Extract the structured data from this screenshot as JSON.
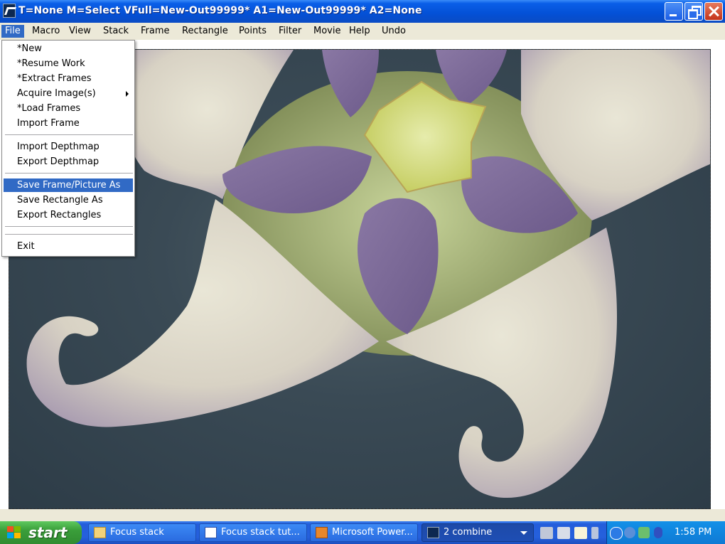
{
  "window": {
    "title": "T=None M=Select VFull=New-Out99999* A1=New-Out99999* A2=None"
  },
  "menubar": {
    "items": [
      {
        "label": "File"
      },
      {
        "label": "Macro"
      },
      {
        "label": "View"
      },
      {
        "label": "Stack"
      },
      {
        "label": "Frame"
      },
      {
        "label": "Rectangle"
      },
      {
        "label": "Points"
      },
      {
        "label": "Filter"
      },
      {
        "label": "Movie"
      },
      {
        "label": "Help"
      },
      {
        "label": "Undo"
      }
    ]
  },
  "file_menu": {
    "items": [
      {
        "label": "*New"
      },
      {
        "label": "*Resume Work"
      },
      {
        "label": "*Extract Frames"
      },
      {
        "label": "Acquire Image(s)"
      },
      {
        "label": "*Load Frames"
      },
      {
        "label": "Import Frame"
      },
      {
        "label": "Import Depthmap"
      },
      {
        "label": "Export Depthmap"
      },
      {
        "label": "Save Frame/Picture As"
      },
      {
        "label": "Save Rectangle As"
      },
      {
        "label": "Export Rectangles"
      },
      {
        "label": "Exit"
      }
    ]
  },
  "taskbar": {
    "start_label": "start",
    "tasks": [
      {
        "label": "Focus stack"
      },
      {
        "label": "Focus stack tut..."
      },
      {
        "label": "Microsoft Power..."
      },
      {
        "label": "2 combine"
      }
    ],
    "clock": "1:58 PM"
  },
  "colors": {
    "highlight": "#316ac5",
    "titlebar": "#0450d6",
    "taskbar": "#245edb",
    "start": "#3a9e3a"
  }
}
